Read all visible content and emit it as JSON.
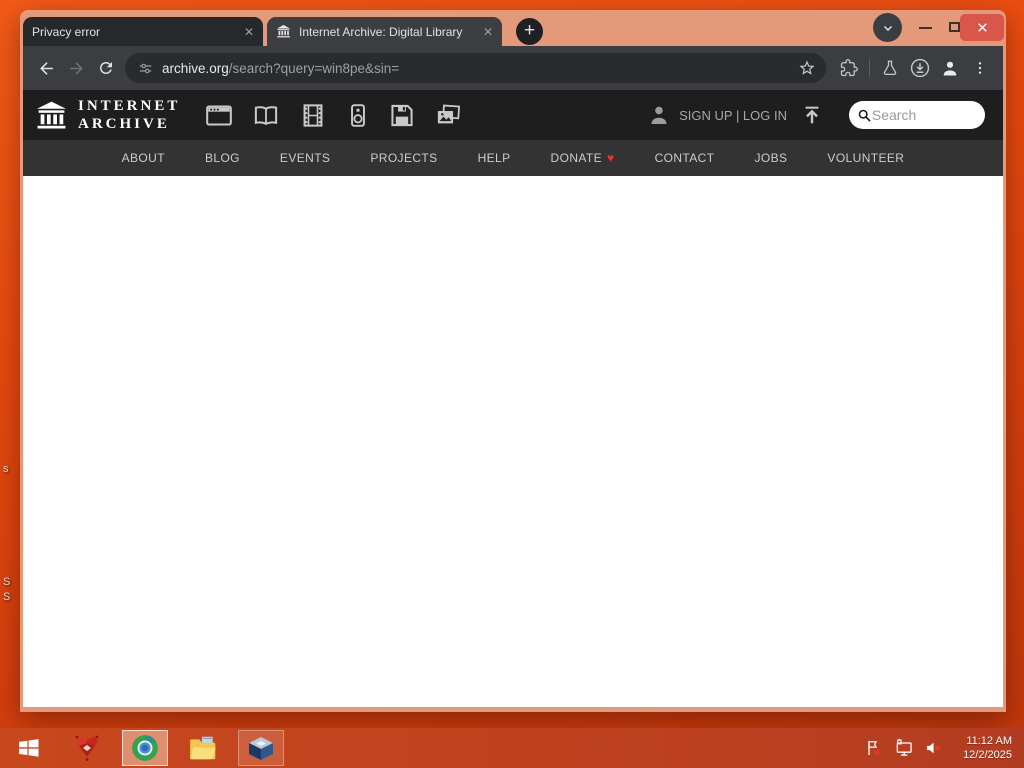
{
  "browser": {
    "tabs": [
      {
        "title": "Privacy error"
      },
      {
        "title": "Internet Archive: Digital Library"
      }
    ],
    "tab_close_glyph": "✕",
    "new_tab_button": "+",
    "url_domain": "archive.org",
    "url_path": "/search?query=win8pe&sin=",
    "toolbar_icons": [
      "back-arrow",
      "forward-arrow",
      "reload",
      "site-settings",
      "bookmark-star",
      "extensions-puzzle",
      "labs-flask",
      "downloads",
      "profile",
      "menu-kebab"
    ]
  },
  "archive_site": {
    "wordmark_line1": "INTERNET",
    "wordmark_line2": "ARCHIVE",
    "media_tabs": [
      "web",
      "texts",
      "video",
      "audio",
      "software",
      "images"
    ],
    "signup_login_label": "SIGN UP | LOG IN",
    "search_placeholder": "Search",
    "nav_items": [
      "ABOUT",
      "BLOG",
      "EVENTS",
      "PROJECTS",
      "HELP",
      "DONATE",
      "CONTACT",
      "JOBS",
      "VOLUNTEER"
    ]
  },
  "desktop": {
    "icon_label_fragments": [
      "s",
      "S",
      "S"
    ]
  },
  "taskbar": {
    "apps": [
      "start",
      "red-app",
      "browser",
      "file-explorer",
      "virtualbox"
    ],
    "tray": [
      "notifications-flag",
      "display",
      "volume-muted"
    ],
    "clock_time": "11:12 AM",
    "clock_date": "12/2/2025"
  },
  "colors": {
    "desktop_orange": "#e8490f",
    "window_frame_salmon": "#e5997b",
    "chrome_toolbar": "#3b3d41",
    "ia_header": "#1e1e1e",
    "ia_navbar": "#333333",
    "donate_heart": "#e63232",
    "close_button_red": "#d8564a"
  }
}
